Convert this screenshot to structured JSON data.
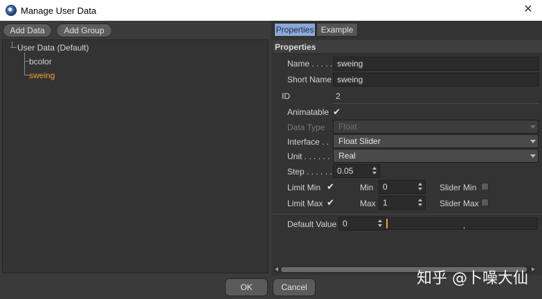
{
  "window": {
    "title": "Manage User Data",
    "close_glyph": "✕"
  },
  "toolbar": {
    "add_data": "Add Data",
    "add_group": "Add Group"
  },
  "tree": {
    "root": "User Data (Default)",
    "children": [
      {
        "label": "bcolor",
        "selected": false
      },
      {
        "label": "sweing",
        "selected": true
      }
    ]
  },
  "tabs": [
    {
      "label": "Properties",
      "active": true
    },
    {
      "label": "Example",
      "active": false
    }
  ],
  "section": {
    "title": "Properties"
  },
  "props": {
    "name_label": "Name . . . . .",
    "name_value": "sweing",
    "short_name_label": "Short Name",
    "short_name_value": "sweing",
    "id_label": "ID",
    "id_value": "2",
    "animatable_label": "Animatable",
    "animatable_checked": true,
    "data_type_label": "Data Type",
    "data_type_value": "Float",
    "interface_label": "Interface . .",
    "interface_value": "Float Slider",
    "unit_label": "Unit . . . . . .",
    "unit_value": "Real",
    "step_label": "Step . . . . . .",
    "step_value": "0.05",
    "limit_min_label": "Limit Min",
    "limit_min_checked": true,
    "min_label": "Min",
    "min_value": "0",
    "slider_min_label": "Slider Min",
    "slider_min_checked": false,
    "limit_max_label": "Limit Max",
    "limit_max_checked": true,
    "max_label": "Max",
    "max_value": "1",
    "slider_max_label": "Slider Max",
    "slider_max_checked": false,
    "default_value_label": "Default Value",
    "default_value": "0",
    "slider_level": 0
  },
  "dialog": {
    "ok": "OK",
    "cancel": "Cancel"
  },
  "watermark": "知乎 @卜噪大仙",
  "colors": {
    "accent": "#f2a033",
    "tab_active": "#8aa7d6",
    "background": "#3a3a3a"
  },
  "icons": {
    "app": "cinema4d-logo-icon",
    "check": "checkmark-icon"
  }
}
